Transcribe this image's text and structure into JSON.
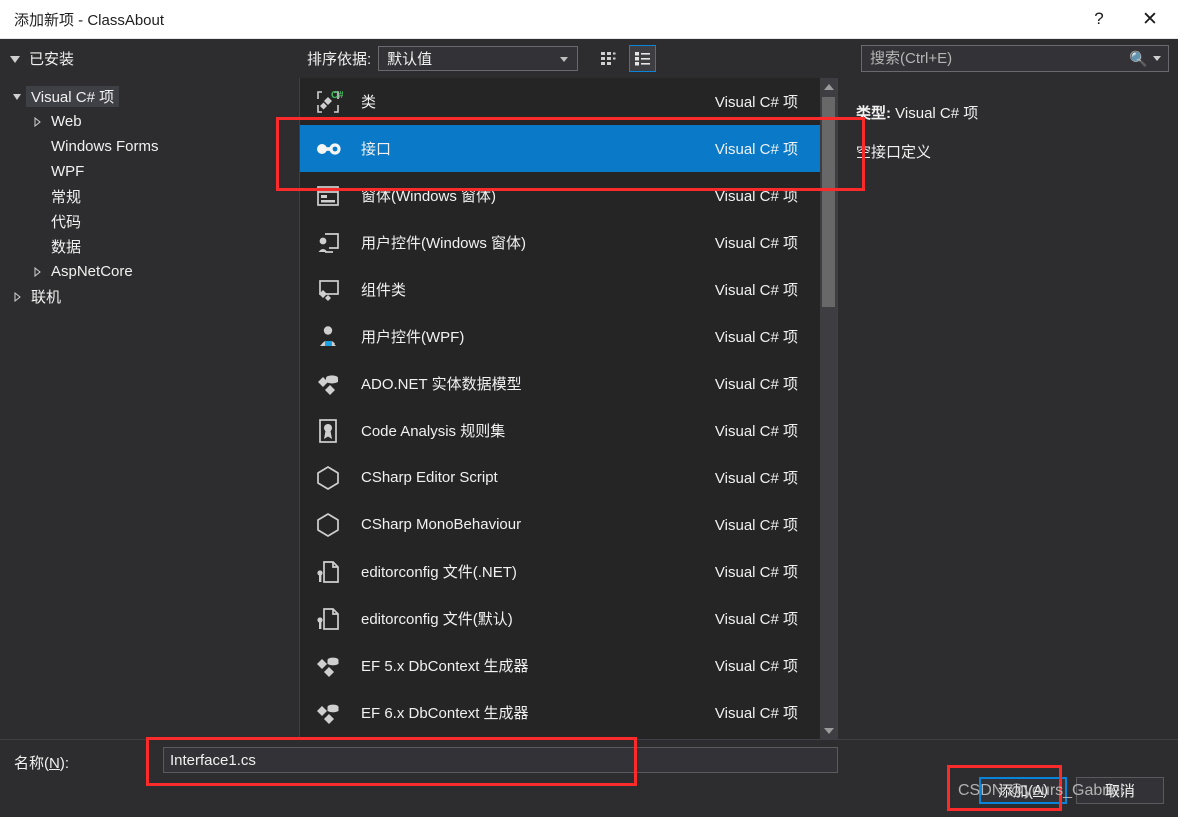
{
  "window": {
    "title": "添加新项 - ClassAbout",
    "help_label": "?",
    "close_label": "✕"
  },
  "toolbar": {
    "installed_label": "已安装",
    "sort_label": "排序依据:",
    "sort_value": "默认值",
    "view_tiles_icon": "grid-view-icon",
    "view_list_icon": "list-view-icon"
  },
  "search": {
    "placeholder": "搜索(Ctrl+E)",
    "value": "",
    "icon": "search-icon"
  },
  "tree": {
    "nodes": [
      {
        "label": "Visual C# 项",
        "level": 1,
        "expander": "expanded",
        "selected": true
      },
      {
        "label": "Web",
        "level": 2,
        "expander": "collapsed",
        "selected": false
      },
      {
        "label": "Windows Forms",
        "level": 2,
        "expander": "none",
        "selected": false
      },
      {
        "label": "WPF",
        "level": 2,
        "expander": "none",
        "selected": false
      },
      {
        "label": "常规",
        "level": 2,
        "expander": "none",
        "selected": false
      },
      {
        "label": "代码",
        "level": 2,
        "expander": "none",
        "selected": false
      },
      {
        "label": "数据",
        "level": 2,
        "expander": "none",
        "selected": false
      },
      {
        "label": "AspNetCore",
        "level": 2,
        "expander": "collapsed",
        "selected": false
      },
      {
        "label": "联机",
        "level": 0,
        "expander": "collapsed",
        "selected": false
      }
    ]
  },
  "list": {
    "items": [
      {
        "name": "类",
        "kind": "Visual C# 项",
        "icon": "class-csharp-icon",
        "selected": false
      },
      {
        "name": "接口",
        "kind": "Visual C# 项",
        "icon": "interface-icon",
        "selected": true
      },
      {
        "name": "窗体(Windows 窗体)",
        "kind": "Visual C# 项",
        "icon": "windows-form-icon",
        "selected": false
      },
      {
        "name": "用户控件(Windows 窗体)",
        "kind": "Visual C# 项",
        "icon": "user-control-winforms-icon",
        "selected": false
      },
      {
        "name": "组件类",
        "kind": "Visual C# 项",
        "icon": "component-class-icon",
        "selected": false
      },
      {
        "name": "用户控件(WPF)",
        "kind": "Visual C# 项",
        "icon": "user-control-wpf-icon",
        "selected": false
      },
      {
        "name": "ADO.NET 实体数据模型",
        "kind": "Visual C# 项",
        "icon": "ado-net-entity-model-icon",
        "selected": false
      },
      {
        "name": "Code Analysis 规则集",
        "kind": "Visual C# 项",
        "icon": "ruleset-icon",
        "selected": false
      },
      {
        "name": "CSharp Editor Script",
        "kind": "Visual C# 项",
        "icon": "cube-icon",
        "selected": false
      },
      {
        "name": "CSharp MonoBehaviour",
        "kind": "Visual C# 项",
        "icon": "cube-icon",
        "selected": false
      },
      {
        "name": "editorconfig 文件(.NET)",
        "kind": "Visual C# 项",
        "icon": "editorconfig-file-icon",
        "selected": false
      },
      {
        "name": "editorconfig 文件(默认)",
        "kind": "Visual C# 项",
        "icon": "editorconfig-file-icon",
        "selected": false
      },
      {
        "name": "EF 5.x DbContext 生成器",
        "kind": "Visual C# 项",
        "icon": "ef-dbcontext-icon",
        "selected": false
      },
      {
        "name": "EF 6.x DbContext 生成器",
        "kind": "Visual C# 项",
        "icon": "ef-dbcontext-icon",
        "selected": false
      }
    ]
  },
  "details": {
    "type_label": "类型:",
    "type_value": "Visual C# 项",
    "description": "空接口定义"
  },
  "footer": {
    "name_label_prefix": "名称(",
    "name_label_key": "N",
    "name_label_suffix": "):",
    "name_value": "Interface1.cs",
    "add_prefix": "添加(",
    "add_key": "A",
    "add_suffix": ")",
    "cancel_label": "取消"
  },
  "watermark": {
    "text": "CSDN @yours_Gabriel"
  },
  "colors": {
    "selection_blue": "#0a7ac8",
    "annotation_red": "#fc2b2b",
    "dialog_bg": "#2d2d30",
    "list_bg": "#252526",
    "titlebar_bg": "#ffffff"
  }
}
